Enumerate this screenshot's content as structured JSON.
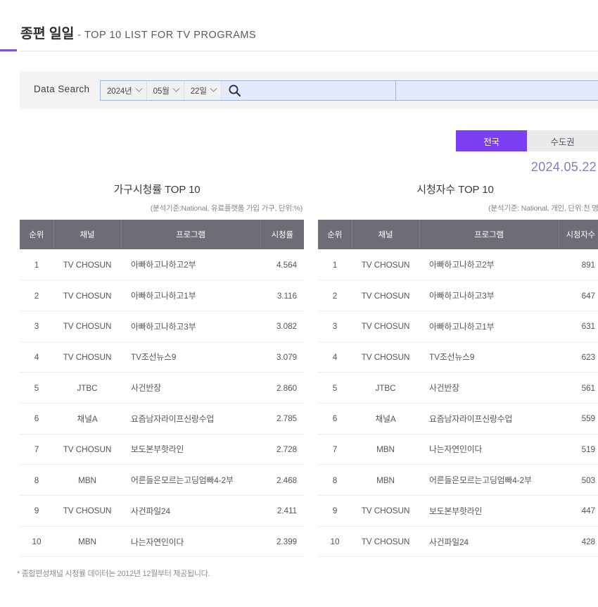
{
  "header": {
    "title_ko": "종편 일일",
    "dash": "-",
    "title_en": "TOP 10 LIST FOR TV PROGRAMS",
    "accent_color": "#8353d6"
  },
  "search": {
    "label": "Data Search",
    "year": "2024년",
    "month": "05월",
    "day": "22일",
    "search_icon": "search-icon",
    "keyword_value": "",
    "keyword_placeholder": "",
    "secondary_value": "",
    "secondary_placeholder": ""
  },
  "region": {
    "options": [
      {
        "label": "전국",
        "active": true
      },
      {
        "label": "수도권",
        "active": false
      }
    ],
    "active_color": "#7b3ef2",
    "inactive_color": "#eaeaec"
  },
  "date_label": "2024.05.22",
  "date_color": "#8b79c4",
  "tables": [
    {
      "id": "household-rating",
      "title": "가구시청률 TOP 10",
      "subtitle": "(분석기준:National, 유료플랫폼 가입 가구, 단위:%)",
      "columns": [
        "순위",
        "채널",
        "프로그램",
        "시청률"
      ],
      "rows": [
        {
          "rank": "1",
          "channel": "TV CHOSUN",
          "program": "아빠하고나하고2부",
          "value": "4.564"
        },
        {
          "rank": "2",
          "channel": "TV CHOSUN",
          "program": "아빠하고나하고1부",
          "value": "3.116"
        },
        {
          "rank": "3",
          "channel": "TV CHOSUN",
          "program": "아빠하고나하고3부",
          "value": "3.082"
        },
        {
          "rank": "4",
          "channel": "TV CHOSUN",
          "program": "TV조선뉴스9",
          "value": "3.079"
        },
        {
          "rank": "5",
          "channel": "JTBC",
          "program": "사건반장",
          "value": "2.860"
        },
        {
          "rank": "6",
          "channel": "채널A",
          "program": "요즘남자라이프신랑수업",
          "value": "2.785"
        },
        {
          "rank": "7",
          "channel": "TV CHOSUN",
          "program": "보도본부핫라인",
          "value": "2.728"
        },
        {
          "rank": "8",
          "channel": "MBN",
          "program": "어른들은모르는고딩엄빠4-2부",
          "value": "2.468"
        },
        {
          "rank": "9",
          "channel": "TV CHOSUN",
          "program": "사건파일24",
          "value": "2.411"
        },
        {
          "rank": "10",
          "channel": "MBN",
          "program": "나는자연인이다",
          "value": "2.399"
        }
      ]
    },
    {
      "id": "viewer-count",
      "title": "시청자수 TOP 10",
      "subtitle": "(분석기준: National, 개인, 단위:천 명)",
      "columns": [
        "순위",
        "채널",
        "프로그램",
        "시청자수"
      ],
      "rows": [
        {
          "rank": "1",
          "channel": "TV CHOSUN",
          "program": "아빠하고나하고2부",
          "value": "891"
        },
        {
          "rank": "2",
          "channel": "TV CHOSUN",
          "program": "아빠하고나하고3부",
          "value": "647"
        },
        {
          "rank": "3",
          "channel": "TV CHOSUN",
          "program": "아빠하고나하고1부",
          "value": "631"
        },
        {
          "rank": "4",
          "channel": "TV CHOSUN",
          "program": "TV조선뉴스9",
          "value": "623"
        },
        {
          "rank": "5",
          "channel": "JTBC",
          "program": "사건반장",
          "value": "561"
        },
        {
          "rank": "6",
          "channel": "채널A",
          "program": "요즘남자라이프신랑수업",
          "value": "559"
        },
        {
          "rank": "7",
          "channel": "MBN",
          "program": "나는자연인이다",
          "value": "519"
        },
        {
          "rank": "8",
          "channel": "MBN",
          "program": "어른들은모르는고딩엄빠4-2부",
          "value": "503"
        },
        {
          "rank": "9",
          "channel": "TV CHOSUN",
          "program": "보도본부핫라인",
          "value": "447"
        },
        {
          "rank": "10",
          "channel": "TV CHOSUN",
          "program": "사건파일24",
          "value": "428"
        }
      ]
    }
  ],
  "footnote": "* 종합편성채널 시청률 데이터는 2012년 12월부터 제공됩니다."
}
